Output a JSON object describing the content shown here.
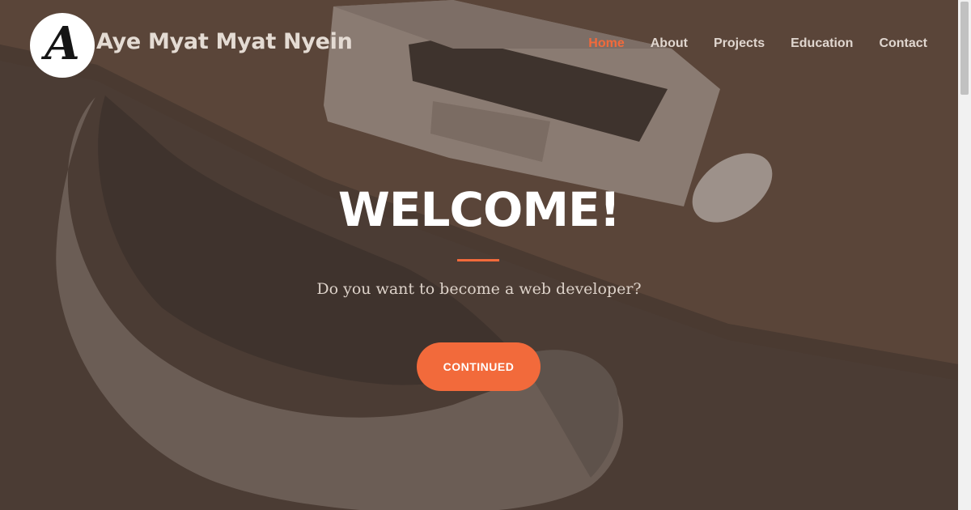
{
  "brand": {
    "logo_letter": "A",
    "name": "Aye Myat Myat Nyein"
  },
  "nav": {
    "items": [
      "Home",
      "About",
      "Projects",
      "Education",
      "Contact"
    ],
    "active": "Home"
  },
  "hero": {
    "title": "WELCOME!",
    "subtitle": "Do you want to become a web developer?",
    "cta_label": "CONTINUED"
  },
  "colors": {
    "accent": "#f26a3b",
    "overlay": "#4e3f36",
    "text": "#ffffff"
  }
}
